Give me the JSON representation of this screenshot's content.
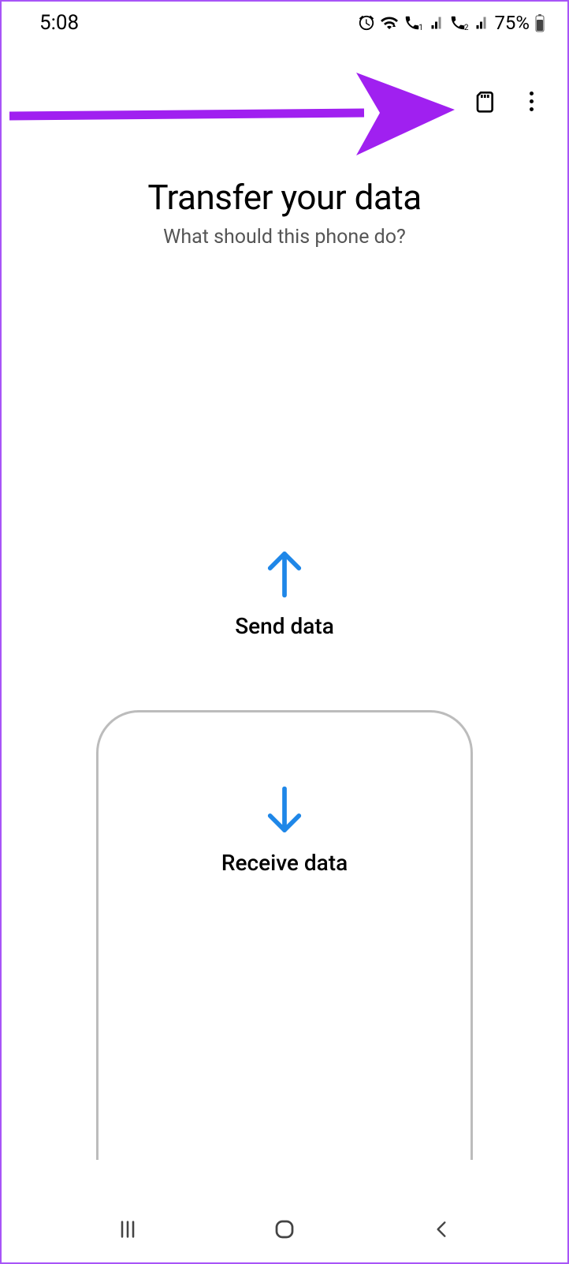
{
  "status_bar": {
    "time": "5:08",
    "battery_percent": "75%"
  },
  "header": {
    "title": "Transfer your data",
    "subtitle": "What should this phone do?"
  },
  "options": {
    "send_label": "Send data",
    "receive_label": "Receive data"
  },
  "colors": {
    "arrow_blue": "#1f87e8",
    "annotation_purple": "#a020f0"
  }
}
